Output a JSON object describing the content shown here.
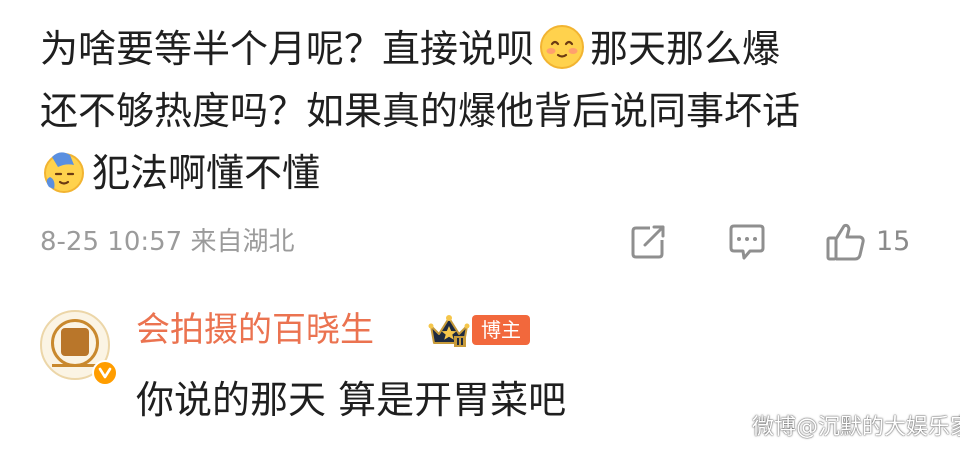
{
  "comment": {
    "line1_a": "为啥要等半个月呢？直接说呗",
    "line1_b": "那天那么爆",
    "line2": "还不够热度吗？如果真的爆他背后说同事坏话",
    "line3": "犯法啊懂不懂",
    "emoji_1": "smile-emoji",
    "emoji_2": "hand-on-head-emoji"
  },
  "meta": {
    "timestamp_location": "8-25 10:57 来自湖北",
    "like_count": "15"
  },
  "reply": {
    "author": "会拍摄的百晓生",
    "role_badge": "博主",
    "text": "你说的那天 算是开胃菜吧"
  },
  "watermark": {
    "text": "微博@沉默的大娱乐家"
  },
  "colors": {
    "text": "#1f1f1f",
    "meta": "#9b9b9b",
    "author": "#eb7350",
    "badge": "#f2683c",
    "verified": "#ff9d00"
  }
}
